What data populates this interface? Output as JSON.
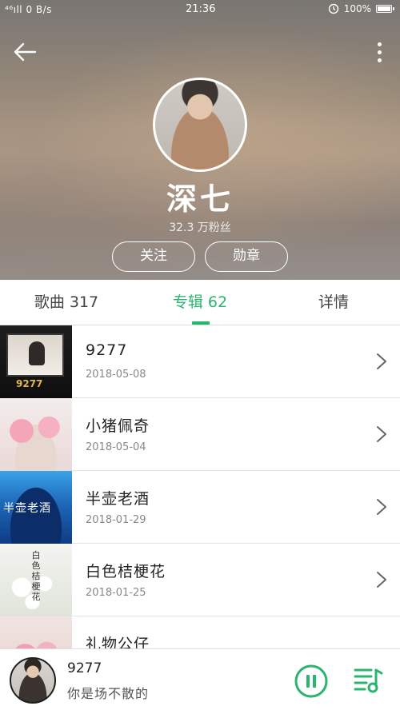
{
  "status_bar": {
    "signal": "⁴⁶ıll",
    "speed": "0 B/s",
    "time": "21:36",
    "battery": "100%"
  },
  "artist": {
    "name": "深七",
    "fans": "32.3 万粉丝",
    "follow_label": "关注",
    "medal_label": "勋章"
  },
  "tabs": [
    {
      "label": "歌曲 317",
      "active": false
    },
    {
      "label": "专辑 62",
      "active": true
    },
    {
      "label": "详情",
      "active": false
    }
  ],
  "albums": [
    {
      "title": "9277",
      "date": "2018-05-08",
      "cover_text": "9277"
    },
    {
      "title": "小猪佩奇",
      "date": "2018-05-04"
    },
    {
      "title": "半壶老酒",
      "date": "2018-01-29",
      "cover_text": "半壶老酒"
    },
    {
      "title": "白色桔梗花",
      "date": "2018-01-25",
      "cover_text": "白色桔梗花"
    },
    {
      "title": "礼物公仔",
      "date": ""
    }
  ],
  "player": {
    "title": "9277",
    "artist": "你是场不散的"
  },
  "colors": {
    "accent": "#2ab56f",
    "text_primary": "#222222",
    "text_secondary": "#888888"
  },
  "icons": {
    "back": "arrow-left-icon",
    "more": "more-vertical-icon",
    "chevron": "chevron-right-icon",
    "pause": "pause-icon",
    "playlist": "playlist-icon"
  }
}
